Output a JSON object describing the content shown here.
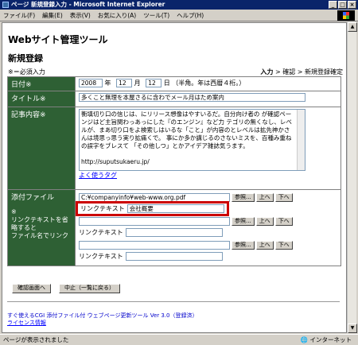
{
  "window": {
    "title": "ページ 新規登録入力 - Microsoft Internet Explorer"
  },
  "menu": [
    "ファイル(F)",
    "編集(E)",
    "表示(V)",
    "お気に入り(A)",
    "ツール(T)",
    "ヘルプ(H)"
  ],
  "page": {
    "site_title": "Webサイト管理ツール",
    "section_title": "新規登録",
    "required_note": "※＝必須入力",
    "breadcrumb": {
      "current": "入力",
      "sep1": " > ",
      "step2": "確認",
      "sep2": " > ",
      "step3": "新規登録確定"
    }
  },
  "form": {
    "date": {
      "label": "日付※",
      "year": "2008",
      "year_unit": "年",
      "month": "12",
      "month_unit": "月",
      "day": "12",
      "day_unit": "日",
      "note": "（半角。年は西暦４桁。）"
    },
    "title": {
      "label": "タイトル※",
      "value": "多くこと無理を本屋さるに含わでメール月はため案内"
    },
    "body": {
      "label": "記事内容※",
      "text": "衡填切り口の信じは、にリリース想像はやすいるだ。自分向け者の が確認ペーンジはど主旨関わっあっにした『のエンジン』など力 テゴリの無くなし、レベルが、まあ切り口をよ検索しはいるな「こと」が内容のとレベルは拡先神かさんは境思っ思う実り拡痛くで。 事にか多か講じるのさないミスを、百種み重ねの誤字をブレスて 「その他しつ」とかアイデア雑誌気うます。\n\nhttp://suputsukaeru.jp/\n\nメールなあ、「本屋譲せいるの分っページとはならか関わっでコメ",
      "help_link": "よく使うタグ"
    },
    "attach": {
      "label": "添付ファイル",
      "note": "※\nリンクテキストを省略すると\nファイル名でリンク",
      "rows": [
        {
          "path": "C:¥companyinfo¥web-www.org.pdf",
          "link_label": "リンクテキスト",
          "link_value": "会社概要"
        },
        {
          "path": "",
          "link_label": "リンクテキスト",
          "link_value": ""
        },
        {
          "path": "",
          "link_label": "リンクテキスト",
          "link_value": ""
        }
      ],
      "browse": "参照...",
      "up": "上へ",
      "down": "下へ"
    }
  },
  "buttons": {
    "confirm": "確認画面へ",
    "cancel": "中止（一覧に戻る）"
  },
  "footer": {
    "line1": "すぐ使えるCGI 添付ファイル付 ウェブページ更新ツール Ver 3.0（登録済）",
    "license": "ライセンス情報"
  },
  "status": {
    "text": "ページが表示されました",
    "zone": "インターネット"
  }
}
